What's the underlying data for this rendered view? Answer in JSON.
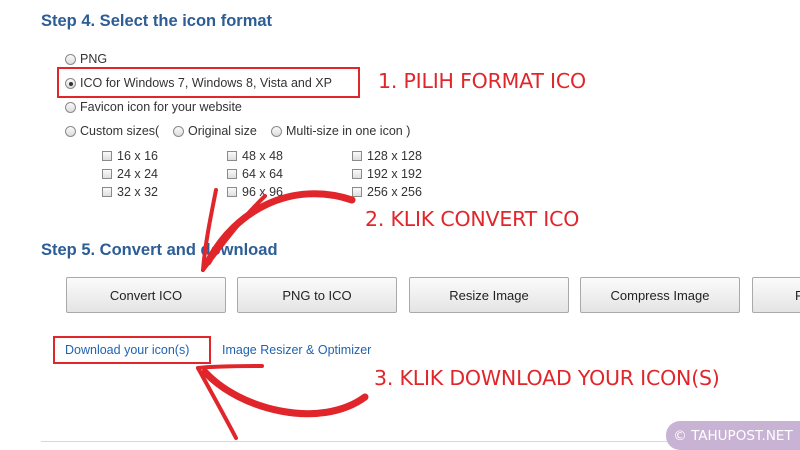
{
  "step4": {
    "heading": "Step 4. Select the icon format",
    "options": {
      "png": "PNG",
      "ico": "ICO for Windows 7, Windows 8, Vista and XP",
      "favicon": "Favicon icon for your website",
      "custom": "Custom sizes(",
      "original": "Original size",
      "multi": "Multi-size in one icon )"
    },
    "selected_option": "ico",
    "sizes": [
      "16 x 16",
      "48 x 48",
      "128 x 128",
      "24 x 24",
      "64 x 64",
      "192 x 192",
      "32 x 32",
      "96 x 96",
      "256 x 256"
    ]
  },
  "step5": {
    "heading": "Step 5. Convert and download",
    "buttons": [
      "Convert ICO",
      "PNG to ICO",
      "Resize Image",
      "Compress Image",
      "P"
    ],
    "links": {
      "download": "Download your icon(s)",
      "resizer": "Image Resizer & Optimizer"
    }
  },
  "annotations": {
    "one": "1. PILIH FORMAT ICO",
    "two": "2. KLIK CONVERT ICO",
    "three": "3. KLIK DOWNLOAD YOUR ICON(S)"
  },
  "watermark": "© TAHUPOST.NET",
  "colors": {
    "heading": "#2c5d95",
    "annotation": "#e0262b",
    "link": "#1f63b0",
    "watermark_bg": "#c9b3d4"
  }
}
